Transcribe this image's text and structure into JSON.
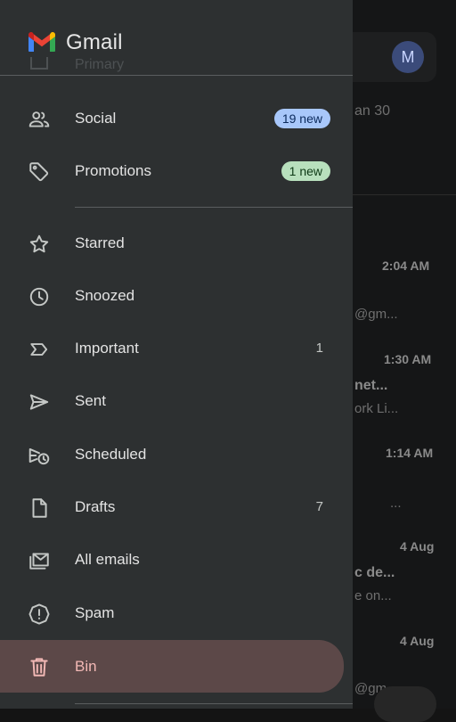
{
  "app": {
    "brand": "Gmail"
  },
  "background": {
    "avatar_letter": "M",
    "fragments": {
      "date_partial": "an 30",
      "t1": "2:04 AM",
      "e1": "@gm...",
      "t2": "1:30 AM",
      "s2": "net...",
      "p2": "ork Li...",
      "t3": "1:14 AM",
      "p3": "...",
      "t4": "4 Aug",
      "s4": "c de...",
      "p4": "e on...",
      "t5": "4 Aug",
      "e5": "@gm"
    }
  },
  "drawer": {
    "hidden_item_label": "Primary",
    "items": [
      {
        "label": "Social",
        "icon": "people-icon",
        "badge": "19 new",
        "badge_color": "#a8c7fa"
      },
      {
        "label": "Promotions",
        "icon": "tag-icon",
        "badge": "1 new",
        "badge_color": "#b8e0bd"
      },
      {
        "label": "Starred",
        "icon": "star-icon"
      },
      {
        "label": "Snoozed",
        "icon": "clock-icon"
      },
      {
        "label": "Important",
        "icon": "important-icon",
        "count": "1"
      },
      {
        "label": "Sent",
        "icon": "send-icon"
      },
      {
        "label": "Scheduled",
        "icon": "scheduled-send-icon"
      },
      {
        "label": "Drafts",
        "icon": "draft-icon",
        "count": "7"
      },
      {
        "label": "All emails",
        "icon": "all-mail-icon"
      },
      {
        "label": "Spam",
        "icon": "spam-icon"
      },
      {
        "label": "Bin",
        "icon": "trash-icon",
        "active": true,
        "active_color": "#f2b8b5"
      }
    ]
  }
}
